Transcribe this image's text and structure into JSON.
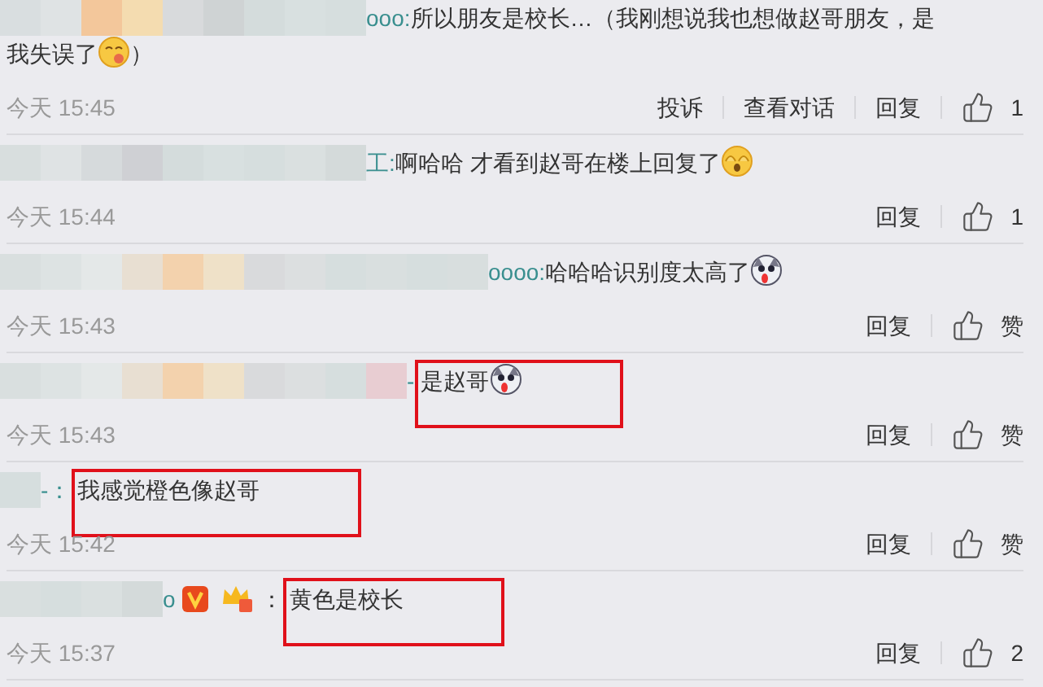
{
  "comments": [
    {
      "name_tail": "ooo:",
      "text": "所以朋友是校长…（我刚想说我也想做赵哥朋友，是",
      "continuation": "我失误了",
      "emoji": {
        "kind": "smiley"
      },
      "text_after": "）",
      "highlighted": false,
      "time": "今天 15:45",
      "actions": [
        "投诉",
        "查看对话",
        "回复"
      ],
      "likes": "1"
    },
    {
      "name_tail": "工:",
      "text": "啊哈哈 才看到赵哥在楼上回复了",
      "emoji": {
        "kind": "covering"
      },
      "highlighted": false,
      "time": "今天 15:44",
      "actions": [
        "回复"
      ],
      "likes": "1"
    },
    {
      "name_tail": "oooo:",
      "text": "哈哈哈识别度太高了",
      "emoji": {
        "kind": "dog"
      },
      "highlighted": false,
      "time": "今天 15:43",
      "actions": [
        "回复"
      ],
      "likes": "赞"
    },
    {
      "name_tail": "-",
      "text": "是赵哥",
      "emoji": {
        "kind": "dog"
      },
      "highlighted": true,
      "time": "今天 15:43",
      "actions": [
        "回复"
      ],
      "likes": "赞"
    },
    {
      "name_tail": "-：",
      "text": "我感觉橙色像赵哥",
      "highlighted": true,
      "time": "今天 15:42",
      "actions": [
        "回复"
      ],
      "likes": "赞"
    },
    {
      "name_tail": "o",
      "badges": [
        {
          "kind": "verified"
        },
        {
          "kind": "crown"
        }
      ],
      "separator": "：",
      "text": "黄色是校长",
      "highlighted": true,
      "time": "今天 15:37",
      "actions": [
        "回复"
      ],
      "likes": "2"
    }
  ]
}
